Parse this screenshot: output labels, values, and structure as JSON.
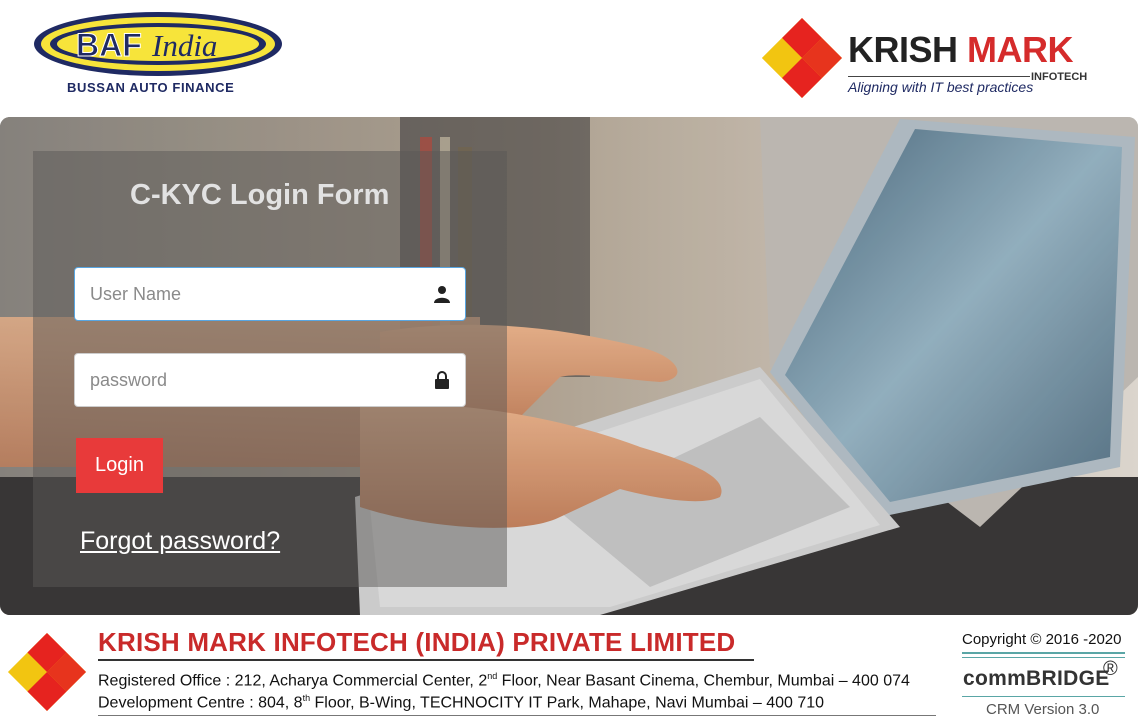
{
  "header": {
    "baf_logo_text": "BAF India",
    "baf_subtitle": "BUSSAN AUTO FINANCE",
    "km_logo_word1": "KRISH",
    "km_logo_word2": "MARK",
    "km_logo_infotech": "INFOTECH",
    "km_logo_tagline": "Aligning with IT best practices"
  },
  "login_form": {
    "title": "C-KYC Login Form",
    "username_placeholder": "User Name",
    "username_value": "",
    "password_placeholder": "password",
    "password_value": "",
    "login_label": "Login",
    "forgot_label": "Forgot password?"
  },
  "footer": {
    "company_name": "KRISH MARK INFOTECH (INDIA) PRIVATE LIMITED",
    "registered_office_prefix": "Registered Office : 212, Acharya Commercial Center, 2",
    "registered_office_sup": "nd",
    "registered_office_suffix": " Floor, Near Basant Cinema, Chembur, Mumbai – 400 074",
    "development_centre_prefix": "Development Centre : 804, 8",
    "development_centre_sup": "th",
    "development_centre_suffix": " Floor, B-Wing, TECHNOCITY IT Park, Mahape, Navi Mumbai – 400 710",
    "copyright": "Copyright © 2016 -2020",
    "product_name": "commBRIDGE",
    "product_mark": "®",
    "product_version": "CRM Version 3.0"
  },
  "icons": {
    "username": "user-icon",
    "password": "lock-icon",
    "brand_mark": "diamond-logo-icon"
  },
  "colors": {
    "accent_red": "#e83a3a",
    "company_red": "#c92a2a",
    "baf_yellow": "#f7e43a",
    "baf_navy": "#1f2a63",
    "focus_blue": "#58a6e2"
  }
}
